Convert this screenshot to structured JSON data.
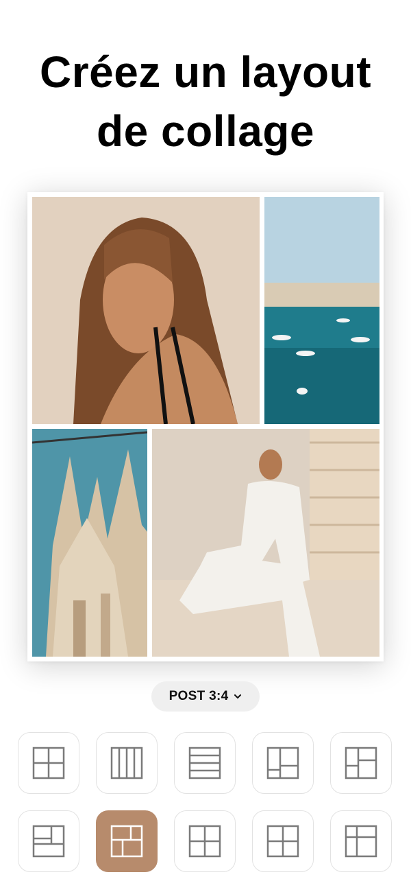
{
  "headline": {
    "line1": "Créez un layout",
    "line2": "de collage"
  },
  "format_selector": {
    "label": "POST 3:4",
    "icon": "chevron-down-icon"
  },
  "colors": {
    "accent": "#b78b6c",
    "icon_stroke": "#7a7a7a",
    "selected_icon_stroke": "#ffffff"
  },
  "layouts": [
    {
      "icon": "layout-grid-2x2-icon",
      "selected": false
    },
    {
      "icon": "layout-columns-4-icon",
      "selected": false
    },
    {
      "icon": "layout-rows-4-icon",
      "selected": false
    },
    {
      "icon": "layout-mixed-a-icon",
      "selected": false
    },
    {
      "icon": "layout-mixed-b-icon",
      "selected": false
    },
    {
      "icon": "layout-mixed-c-icon",
      "selected": false
    },
    {
      "icon": "layout-mixed-d-icon",
      "selected": true
    },
    {
      "icon": "layout-grid-2x2-icon",
      "selected": false
    },
    {
      "icon": "layout-grid-2x2-icon",
      "selected": false
    },
    {
      "icon": "layout-mixed-e-icon",
      "selected": false
    }
  ]
}
